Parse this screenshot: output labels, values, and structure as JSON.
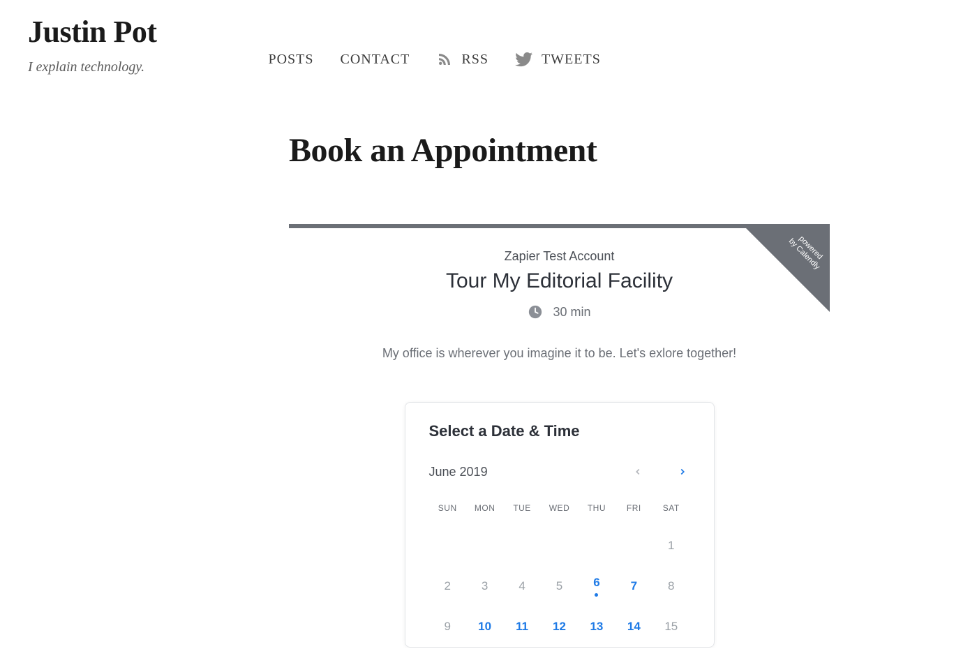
{
  "site": {
    "title": "Justin Pot",
    "tagline": "I explain technology."
  },
  "nav": {
    "posts": "POSTS",
    "contact": "CONTACT",
    "rss": "RSS",
    "tweets": "TWEETS"
  },
  "page": {
    "heading": "Book an Appointment"
  },
  "embed": {
    "badge_line1": "powered",
    "badge_line2": "by Calendly",
    "account": "Zapier Test Account",
    "event_title": "Tour My Editorial Facility",
    "duration": "30 min",
    "description": "My office is wherever you imagine it to be. Let's exlore together!"
  },
  "calendar": {
    "heading": "Select a Date & Time",
    "month_label": "June 2019",
    "dow": [
      "SUN",
      "MON",
      "TUE",
      "WED",
      "THU",
      "FRI",
      "SAT"
    ],
    "weeks": [
      [
        {
          "n": "",
          "a": false
        },
        {
          "n": "",
          "a": false
        },
        {
          "n": "",
          "a": false
        },
        {
          "n": "",
          "a": false
        },
        {
          "n": "",
          "a": false
        },
        {
          "n": "",
          "a": false
        },
        {
          "n": "1",
          "a": false
        }
      ],
      [
        {
          "n": "2",
          "a": false
        },
        {
          "n": "3",
          "a": false
        },
        {
          "n": "4",
          "a": false
        },
        {
          "n": "5",
          "a": false
        },
        {
          "n": "6",
          "a": true,
          "today": true
        },
        {
          "n": "7",
          "a": true
        },
        {
          "n": "8",
          "a": false
        }
      ],
      [
        {
          "n": "9",
          "a": false
        },
        {
          "n": "10",
          "a": true
        },
        {
          "n": "11",
          "a": true
        },
        {
          "n": "12",
          "a": true
        },
        {
          "n": "13",
          "a": true
        },
        {
          "n": "14",
          "a": true
        },
        {
          "n": "15",
          "a": false
        }
      ]
    ]
  }
}
